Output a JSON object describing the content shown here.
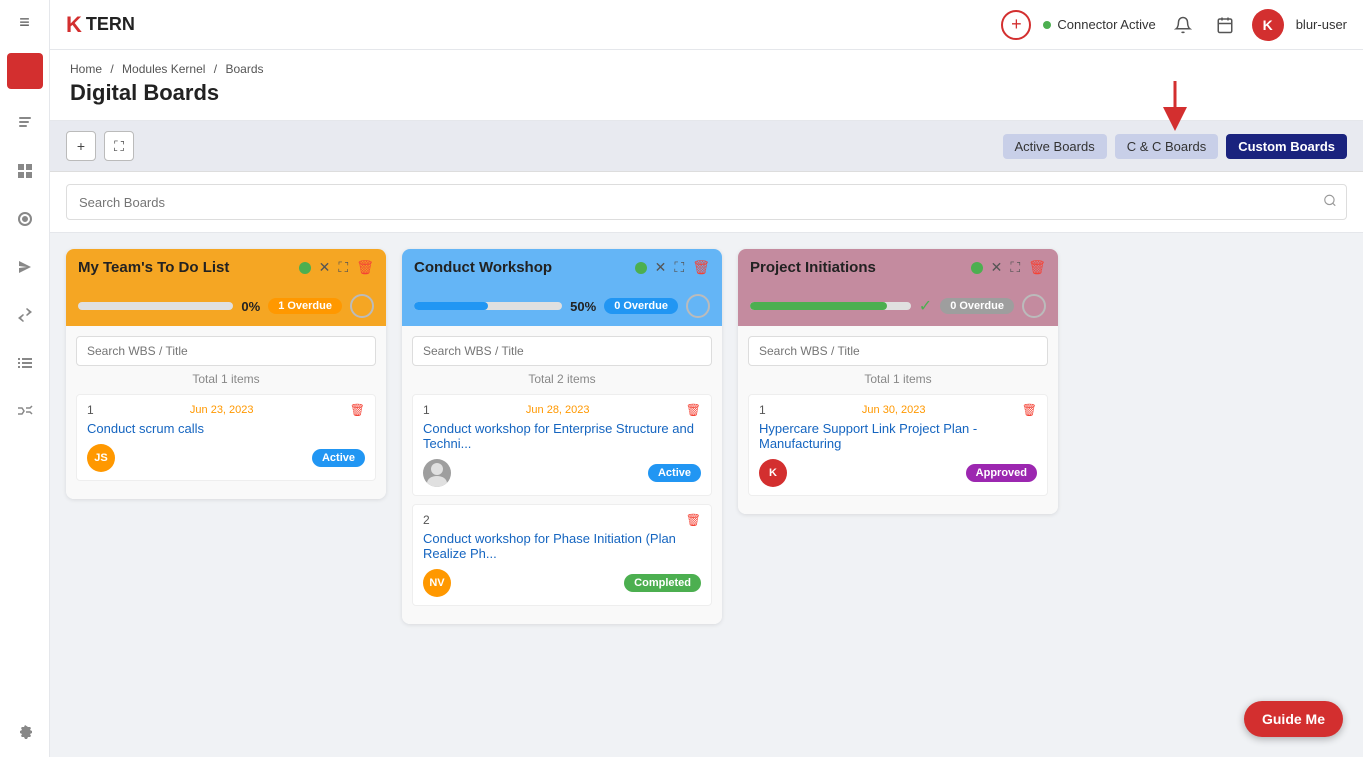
{
  "app": {
    "logo_k": "K",
    "logo_tern": "TERN"
  },
  "topnav": {
    "connector_label": "Connector Active",
    "connector_status": "active",
    "user_initial": "K",
    "user_name": "blur-user"
  },
  "breadcrumb": {
    "home": "Home",
    "sep1": "/",
    "modules": "Modules Kernel",
    "sep2": "/",
    "boards": "Boards"
  },
  "page": {
    "title": "Digital Boards"
  },
  "toolbar": {
    "add_label": "+",
    "expand_label": "⛶",
    "filter_active": "Active Boards",
    "filter_cc": "C & C Boards",
    "filter_custom": "Custom Boards"
  },
  "search": {
    "placeholder": "Search Boards"
  },
  "boards": [
    {
      "id": "board1",
      "title": "My Team's To Do List",
      "header_color": "#f5a623",
      "status_dot_color": "#4caf50",
      "progress_pct": 0,
      "progress_pct_label": "0%",
      "progress_color": "#e0e0e0",
      "overdue_count": "1 Overdue",
      "overdue_type": "orange",
      "total_label": "Total 1 items",
      "items": [
        {
          "num": "1",
          "date": "Jun 23, 2023",
          "title": "Conduct scrum calls",
          "avatar_initials": "JS",
          "avatar_color": "#ff9800",
          "status": "Active",
          "status_type": "active"
        }
      ]
    },
    {
      "id": "board2",
      "title": "Conduct Workshop",
      "header_color": "#64b5f6",
      "status_dot_color": "#4caf50",
      "progress_pct": 50,
      "progress_pct_label": "50%",
      "progress_color": "#2196f3",
      "overdue_count": "0 Overdue",
      "overdue_type": "blue",
      "total_label": "Total 2 items",
      "items": [
        {
          "num": "1",
          "date": "Jun 28, 2023",
          "title": "Conduct workshop for Enterprise Structure and Techni...",
          "avatar_initials": "img",
          "avatar_color": "#9e9e9e",
          "status": "Active",
          "status_type": "active"
        },
        {
          "num": "2",
          "date": "",
          "title": "Conduct workshop for Phase Initiation (Plan Realize Ph...",
          "avatar_initials": "NV",
          "avatar_color": "#ff9800",
          "status": "Completed",
          "status_type": "completed"
        }
      ]
    },
    {
      "id": "board3",
      "title": "Project Initiations",
      "header_color": "#c48b9f",
      "status_dot_color": "#4caf50",
      "progress_pct": 85,
      "progress_pct_label": "",
      "progress_color": "#4caf50",
      "overdue_count": "0 Overdue",
      "overdue_type": "gray",
      "total_label": "Total 1 items",
      "items": [
        {
          "num": "1",
          "date": "Jun 30, 2023",
          "title": "Hypercare Support Link Project Plan - Manufacturing",
          "avatar_initials": "K",
          "avatar_color": "#d32f2f",
          "status": "Approved",
          "status_type": "approved"
        }
      ]
    }
  ],
  "guide_me": "Guide Me",
  "sidebar": {
    "items": [
      {
        "icon": "≡",
        "name": "menu"
      },
      {
        "icon": "📋",
        "name": "notes"
      },
      {
        "icon": "⊞",
        "name": "grid"
      },
      {
        "icon": "◎",
        "name": "circle"
      },
      {
        "icon": "✈",
        "name": "send"
      },
      {
        "icon": "⇄",
        "name": "exchange"
      },
      {
        "icon": "☰",
        "name": "list"
      },
      {
        "icon": "⊕",
        "name": "shuffle"
      },
      {
        "icon": "⚙",
        "name": "settings"
      }
    ]
  }
}
